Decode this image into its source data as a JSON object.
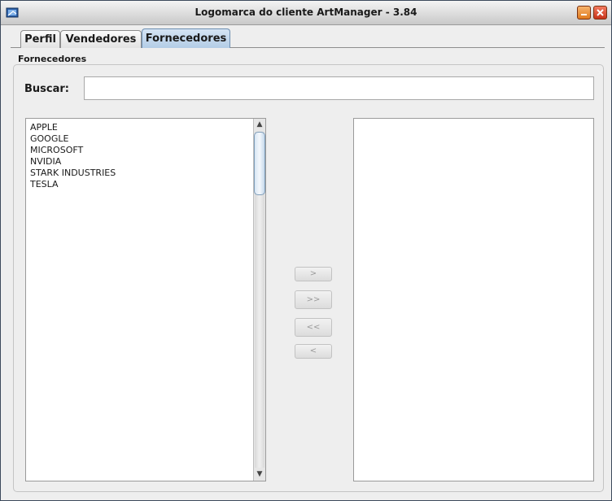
{
  "window": {
    "title": "Logomarca do cliente ArtManager - 3.84",
    "icons": [
      "app-icon",
      "minimize-icon",
      "close-icon"
    ]
  },
  "tabs": [
    {
      "label": "Perfil",
      "active": false
    },
    {
      "label": "Vendedores",
      "active": false
    },
    {
      "label": "Fornecedores",
      "active": true
    }
  ],
  "section": {
    "label": "Fornecedores"
  },
  "search": {
    "label": "Buscar:",
    "value": "",
    "placeholder": ""
  },
  "available_list": {
    "items": [
      "APPLE",
      "GOOGLE",
      "MICROSOFT",
      "NVIDIA",
      "STARK INDUSTRIES",
      "TESLA"
    ]
  },
  "selected_list": {
    "items": []
  },
  "transfer_buttons": {
    "add_one": ">",
    "add_all": ">>",
    "remove_all": "<<",
    "remove_one": "<"
  },
  "colors": {
    "active_tab": "#b3cde6",
    "close_button": "#c8331a",
    "minimize_button": "#e07b1f",
    "scroll_thumb": "#d8e6f4"
  }
}
